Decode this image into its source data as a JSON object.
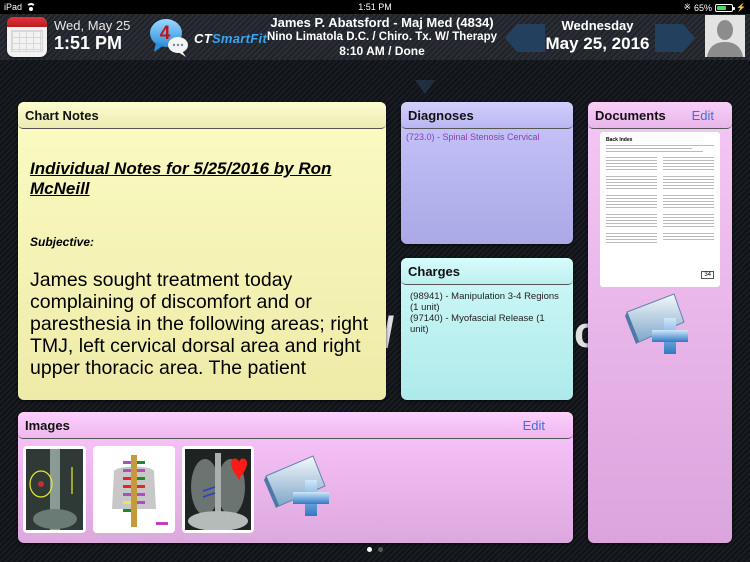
{
  "status_bar": {
    "device": "iPad",
    "time": "1:51 PM",
    "battery_percent": "65%",
    "battery_level": 0.65
  },
  "header": {
    "date_short": "Wed, May 25",
    "time": "1:51 PM",
    "message_count": "4",
    "brand_ct": "CT",
    "brand_smartfit": "SmartFit",
    "patient_name": "James P. Abatsford - Maj Med (4834)",
    "provider": "Nino Limatola D.C. / Chiro. Tx. W/ Therapy",
    "appointment": "8:10 AM / Done",
    "day_name": "Wednesday",
    "full_date": "May 25, 2016"
  },
  "icons": {
    "calendar": "calendar-icon",
    "messages": "chat-bubble-icon",
    "prev": "chevron-left-icon",
    "next": "chevron-right-icon",
    "avatar": "user-silhouette-icon",
    "add_folder": "folder-plus-icon"
  },
  "chart_notes": {
    "title": "Chart Notes",
    "note_heading": "Individual Notes for 5/25/2016 by Ron McNeill",
    "section_label": "Subjective:",
    "note_text": "James sought treatment today complaining of discomfort and or paresthesia in the following areas; right TMJ, left cervical dorsal area and right upper thoracic area. The patient"
  },
  "diagnoses": {
    "title": "Diagnoses",
    "items": [
      "(723.0) - Spinal Stenosis Cervical"
    ]
  },
  "charges": {
    "title": "Charges",
    "items": [
      "(98941) - Manipulation 3-4 Regions (1 unit)",
      "(97140) - Myofascial Release (1 unit)"
    ]
  },
  "documents": {
    "title": "Documents",
    "edit_label": "Edit",
    "thumbnail": {
      "title": "Back Index",
      "score": "34"
    }
  },
  "images": {
    "title": "Images",
    "edit_label": "Edit",
    "thumbnails": [
      {
        "label": "lumbar-xray"
      },
      {
        "label": "spine-chart"
      },
      {
        "label": "chest-xray"
      }
    ]
  },
  "pagination": {
    "pages": 2,
    "current": 1
  }
}
